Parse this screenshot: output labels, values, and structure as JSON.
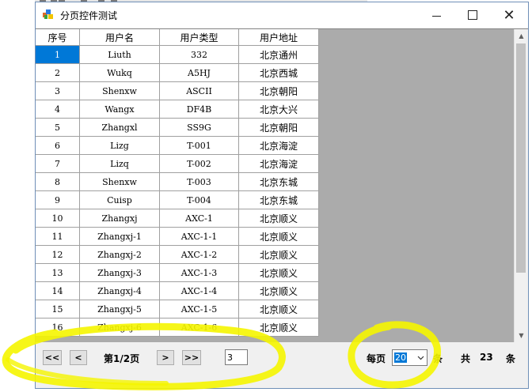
{
  "window": {
    "title": "分页控件测试",
    "minimize_glyph": "",
    "close_glyph": "✕"
  },
  "grid": {
    "columns": [
      "序号",
      "用户名",
      "用户类型",
      "用户地址"
    ],
    "rows": [
      [
        "1",
        "Liuth",
        "332",
        "北京通州"
      ],
      [
        "2",
        "Wukq",
        "A5HJ",
        "北京西城"
      ],
      [
        "3",
        "Shenxw",
        "ASCII",
        "北京朝阳"
      ],
      [
        "4",
        "Wangx",
        "DF4B",
        "北京大兴"
      ],
      [
        "5",
        "Zhangxl",
        "SS9G",
        "北京朝阳"
      ],
      [
        "6",
        "Lizg",
        "T-001",
        "北京海淀"
      ],
      [
        "7",
        "Lizq",
        "T-002",
        "北京海淀"
      ],
      [
        "8",
        "Shenxw",
        "T-003",
        "北京东城"
      ],
      [
        "9",
        "Cuisp",
        "T-004",
        "北京东城"
      ],
      [
        "10",
        "Zhangxj",
        "AXC-1",
        "北京顺义"
      ],
      [
        "11",
        "Zhangxj-1",
        "AXC-1-1",
        "北京顺义"
      ],
      [
        "12",
        "Zhangxj-2",
        "AXC-1-2",
        "北京顺义"
      ],
      [
        "13",
        "Zhangxj-3",
        "AXC-1-3",
        "北京顺义"
      ],
      [
        "14",
        "Zhangxj-4",
        "AXC-1-4",
        "北京顺义"
      ],
      [
        "15",
        "Zhangxj-5",
        "AXC-1-5",
        "北京顺义"
      ],
      [
        "16",
        "Zhangxj-6",
        "AXC-1-6",
        "北京顺义"
      ]
    ],
    "selected_cell_color": "#0078d7"
  },
  "pager": {
    "first_label": "<<",
    "prev_label": "<",
    "next_label": ">",
    "last_label": ">>",
    "page_label": "第1/2页",
    "page_input_value": "3",
    "per_page_label": "每页",
    "page_size_value": "20",
    "unit_label": "条",
    "total_prefix": "共",
    "total_value": "23",
    "total_unit": "条"
  },
  "colors": {
    "highlight": "#f5f500",
    "selection": "#0078d7"
  }
}
